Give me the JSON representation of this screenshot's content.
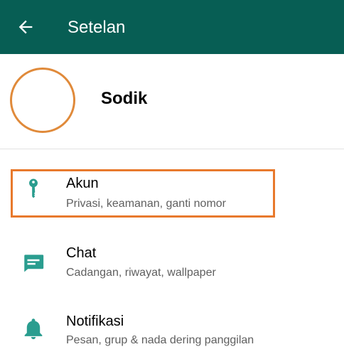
{
  "header": {
    "title": "Setelan",
    "back_icon": "arrow-left-icon",
    "background": "#075e54"
  },
  "profile": {
    "name": "Sodik",
    "avatar_border_color": "#e08a3a"
  },
  "settings": {
    "items": [
      {
        "title": "Akun",
        "subtitle": "Privasi, keamanan, ganti nomor",
        "icon": "key-icon"
      },
      {
        "title": "Chat",
        "subtitle": "Cadangan, riwayat, wallpaper",
        "icon": "chat-icon"
      },
      {
        "title": "Notifikasi",
        "subtitle": "Pesan, grup & nada dering panggilan",
        "icon": "bell-icon"
      }
    ],
    "icon_color": "#2a9d8f",
    "highlight_color": "#e8792c"
  }
}
